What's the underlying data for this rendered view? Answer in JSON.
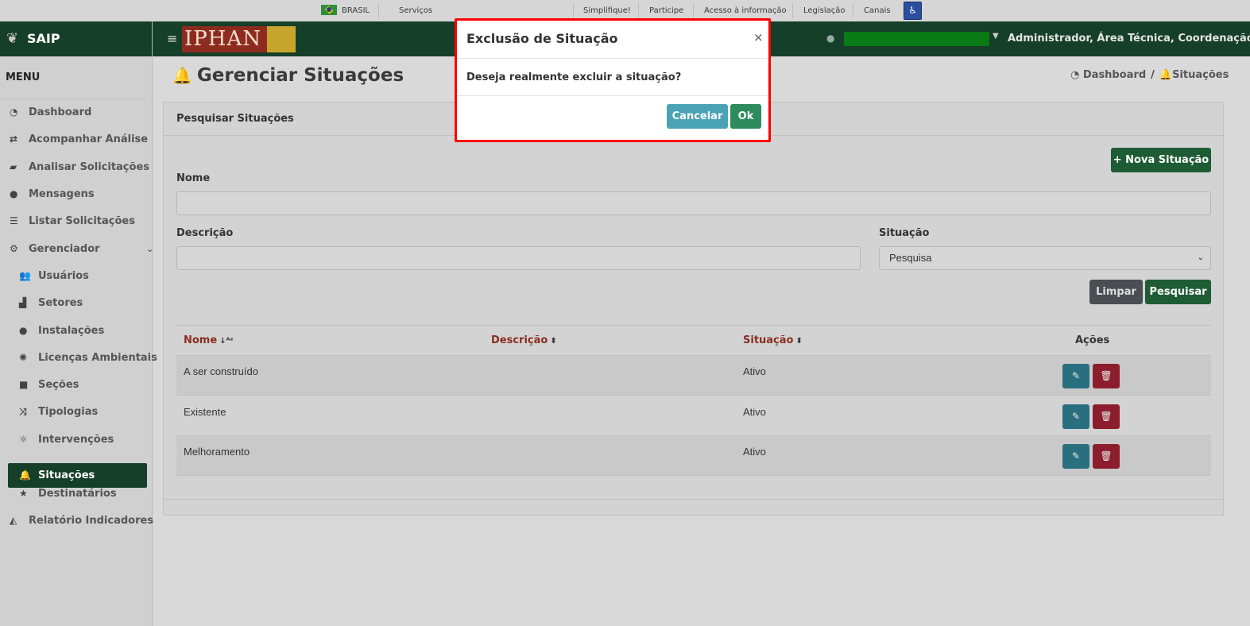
{
  "govbar": {
    "country": "BRASIL",
    "servicos": "Serviços",
    "simplifique": "Simplifique!",
    "participe": "Participe",
    "acesso": "Acesso à informação",
    "legislacao": "Legislação",
    "canais": "Canais"
  },
  "sidebar": {
    "brand": "SAIP",
    "menu_title": "MENU",
    "items": [
      {
        "label": "Dashboard"
      },
      {
        "label": "Acompanhar Análise"
      },
      {
        "label": "Analisar Solicitações"
      },
      {
        "label": "Mensagens"
      },
      {
        "label": "Listar Solicitações"
      },
      {
        "label": "Gerenciador"
      },
      {
        "label": "Usuários"
      },
      {
        "label": "Setores"
      },
      {
        "label": "Instalações"
      },
      {
        "label": "Licenças Ambientais"
      },
      {
        "label": "Seções"
      },
      {
        "label": "Tipologias"
      },
      {
        "label": "Intervenções"
      },
      {
        "label": "Situações"
      },
      {
        "label": "Destinatários"
      },
      {
        "label": "Relatório Indicadores"
      }
    ]
  },
  "topbar": {
    "logo_text": "IPHAN",
    "user": "Administrador, Área Técnica, Coordenação..."
  },
  "page": {
    "title": "Gerenciar Situações",
    "breadcrumb": [
      "Dashboard",
      "/",
      "Situações"
    ]
  },
  "search": {
    "card_title": "Pesquisar Situações",
    "new_button": "+ Nova Situação",
    "nome_label": "Nome",
    "nome_value": "",
    "descricao_label": "Descrição",
    "descricao_value": "",
    "situacao_label": "Situação",
    "situacao_value": "Pesquisa",
    "clear_button": "Limpar",
    "search_button": "Pesquisar"
  },
  "table": {
    "headers": [
      "Nome",
      "Descrição",
      "Situação",
      "Ações"
    ],
    "rows": [
      {
        "nome": "A ser construído",
        "descricao": "",
        "situacao": "Ativo"
      },
      {
        "nome": "Existente",
        "descricao": "",
        "situacao": "Ativo"
      },
      {
        "nome": "Melhoramento",
        "descricao": "",
        "situacao": "Ativo"
      }
    ]
  },
  "modal": {
    "title": "Exclusão de Situação",
    "close": "×",
    "message": "Deseja realmente excluir a situação?",
    "cancel": "Cancelar",
    "ok": "Ok"
  },
  "colors": {
    "brand_green": "#163f29",
    "header_link": "#8a2d22",
    "highlight_border": "#ff0000"
  }
}
